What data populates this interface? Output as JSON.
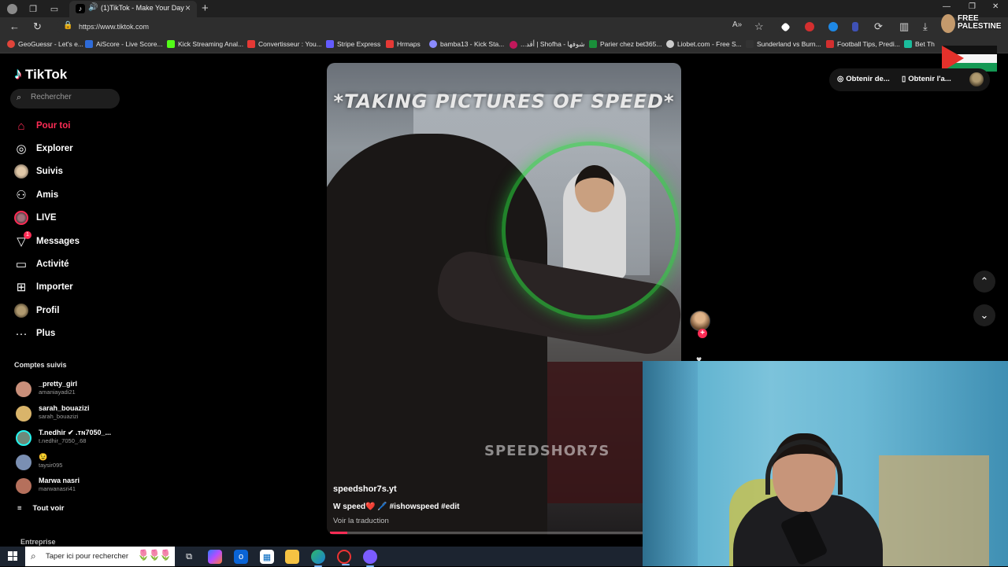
{
  "browser": {
    "tab_title": "(1)TikTok - Make Your Day",
    "url": "https://www.tiktok.com",
    "bookmarks": [
      {
        "label": "GeoGuessr - Let's e...",
        "color": "#e0443a"
      },
      {
        "label": "AiScore - Live Score...",
        "color": "#2e6bd8"
      },
      {
        "label": "Kick Streaming Anal...",
        "color": "#53fc18"
      },
      {
        "label": "Convertisseur : You...",
        "color": "#e53935"
      },
      {
        "label": "Stripe Express",
        "color": "#635bff"
      },
      {
        "label": "Hrmaps",
        "color": "#e53935"
      },
      {
        "label": "bamba13 - Kick Sta...",
        "color": "#8a8aff"
      },
      {
        "label": "...أقد | Shofha - شوفها",
        "color": "#c2185b"
      },
      {
        "label": "Parier chez bet365...",
        "color": "#1a8f3a"
      },
      {
        "label": "Liobet.com - Free S...",
        "color": "#cccccc"
      },
      {
        "label": "Sunderland vs Burn...",
        "color": "#333333"
      },
      {
        "label": "Football Tips, Predi...",
        "color": "#d32f2f"
      },
      {
        "label": "Bet Th",
        "color": "#1abc9c"
      }
    ],
    "badge_text": "FREE PALESTINE"
  },
  "tiktok": {
    "logo": "TikTok",
    "search_placeholder": "Rechercher",
    "nav": [
      {
        "label": "Pour toi",
        "icon": "home-icon"
      },
      {
        "label": "Explorer",
        "icon": "compass-icon"
      },
      {
        "label": "Suivis",
        "icon": "following-avatar-icon"
      },
      {
        "label": "Amis",
        "icon": "friends-icon"
      },
      {
        "label": "LIVE",
        "icon": "live-icon"
      },
      {
        "label": "Messages",
        "icon": "messages-icon",
        "badge": "1"
      },
      {
        "label": "Activité",
        "icon": "activity-icon"
      },
      {
        "label": "Importer",
        "icon": "upload-icon"
      },
      {
        "label": "Profil",
        "icon": "profile-avatar-icon"
      },
      {
        "label": "Plus",
        "icon": "more-icon"
      }
    ],
    "following_header": "Comptes suivis",
    "following": [
      {
        "name": "_pretty_girl",
        "handle": "amaniayadi21",
        "color": "#c98f7a"
      },
      {
        "name": "sarah_bouazizi",
        "handle": "sarah_bouazizi",
        "color": "#d9b46a"
      },
      {
        "name": "T.nedhir ✔ .тɴ7050_...",
        "handle": "t.nedhir_7050_.68",
        "color": "#6d8a7a"
      },
      {
        "name": "😉",
        "handle": "taysir095",
        "color": "#7a8fb2"
      },
      {
        "name": "Marwa nasri",
        "handle": "marwanasri41",
        "color": "#b5705c"
      }
    ],
    "see_all": "Tout voir",
    "section_corp": "Entreprise",
    "top_actions": [
      "Obtenir de...",
      "Obtenir l'a..."
    ]
  },
  "video": {
    "overlay_title": "*TAKING PICTURES OF SPEED*",
    "watermark": "SPEEDSHOR7S",
    "author": "speedshor7s.yt",
    "caption": "W speed❤️ 🖊️ #ishowspeed #edit",
    "translate": "Voir la traduction",
    "progress": 0.05
  },
  "taskbar": {
    "search_placeholder": "Taper ici pour rechercher",
    "flowers": "🌷🌷🌷"
  }
}
